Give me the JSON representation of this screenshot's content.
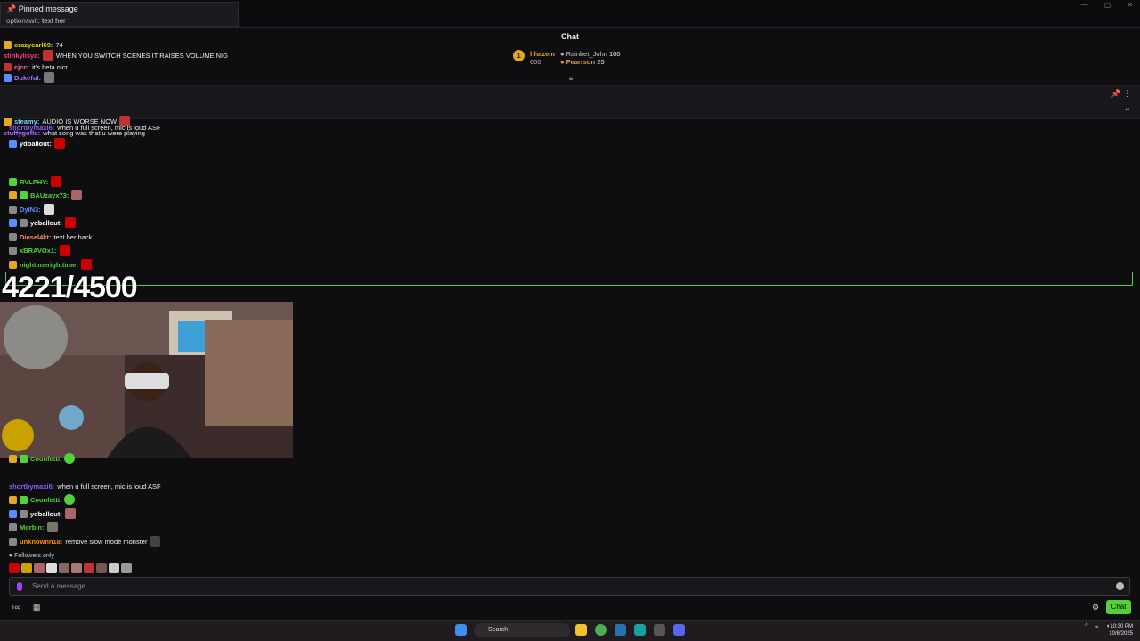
{
  "pinned": {
    "title": "Pinned message",
    "author": "optionswit",
    "text": "text her"
  },
  "header": {
    "title": "Chat"
  },
  "leaderboard": {
    "rank": "1",
    "first": {
      "name": "hhazem",
      "points": "600"
    },
    "others": [
      {
        "name": "Rainbet_John",
        "points": "100"
      },
      {
        "name": "Pearrson",
        "points": "25"
      }
    ]
  },
  "messages_top": [
    {
      "user": "crazycarl69:",
      "text": "74",
      "color": "#d8d800"
    },
    {
      "user": "stinkylisya:",
      "text": "WHEN YOU SWITCH SCENES IT RAISES VOLUME NIG",
      "color": "#ff3b7a"
    },
    {
      "user": "cjcc:",
      "text": "it's beta nicr",
      "color": "#ff6fa2"
    },
    {
      "user": "Dukeful:",
      "text": "",
      "color": "#a970ff"
    },
    {
      "user": "steamy:",
      "text": "AUDIO IS WORSE NOW",
      "color": "#7ad7ff"
    },
    {
      "user": "shortbymaxi6:",
      "text": "when u full screen, mic is loud ASF",
      "color": "#8a5cff"
    },
    {
      "user": "stuffygoflo:",
      "text": "what song was that u were playing",
      "color": "#b36bff"
    }
  ],
  "messages_mid": [
    {
      "user": "ydballout:",
      "text": "",
      "color": "#ffffff"
    },
    {
      "user": "RVLPHY:",
      "text": "",
      "color": "#53d13a"
    },
    {
      "user": "BAUzayx73:",
      "text": "",
      "color": "#53d13a"
    },
    {
      "user": "DylN3:",
      "text": "",
      "color": "#5b8dff"
    },
    {
      "user": "ydballout:",
      "text": "",
      "color": "#ffffff"
    },
    {
      "user": "Diesel4kt:",
      "text": "text her back",
      "color": "#ff8c5b"
    },
    {
      "user": "xBRAVOx1:",
      "text": "",
      "color": "#53d13a"
    },
    {
      "user": "nightimerighttime:",
      "text": "",
      "color": "#53d13a"
    }
  ],
  "counter": "4221/4500",
  "messages_bottom": [
    {
      "user": "Coonfetti:",
      "text": "",
      "color": "#53d13a"
    },
    {
      "user": "shortbymaxi6:",
      "text": "when u full screen, mic is loud ASF",
      "color": "#8a5cff"
    },
    {
      "user": "Coonfetti:",
      "text": "",
      "color": "#53d13a"
    },
    {
      "user": "ydballout:",
      "text": "",
      "color": "#ffffff"
    },
    {
      "user": "Morbin:",
      "text": "",
      "color": "#53d13a"
    },
    {
      "user": "unknownn18:",
      "text": "remove slow mode monster",
      "color": "#ff8c00"
    }
  ],
  "followers_only": "Followers only",
  "input": {
    "placeholder": "Send a message"
  },
  "chat_button": "Chat",
  "taskbar": {
    "search": "Search",
    "time": "10:30 PM",
    "date": "10/6/2025"
  }
}
